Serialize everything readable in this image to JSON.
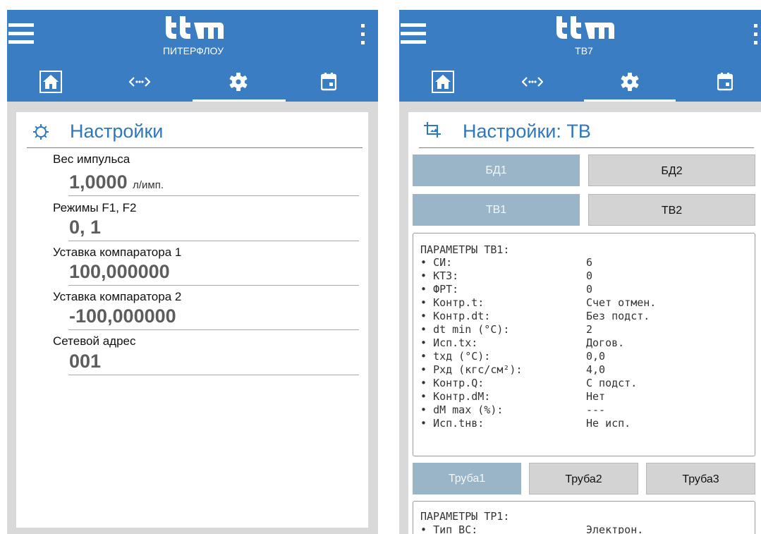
{
  "logo_text": "ttm",
  "left_screen": {
    "device_name": "ПИТЕРФЛОУ",
    "card_title": "Настройки",
    "settings": [
      {
        "label": "Вес импульса",
        "value": "1,0000",
        "unit": "л/имп."
      },
      {
        "label": "Режимы F1, F2",
        "value": "0, 1"
      },
      {
        "label": "Уставка компаратора 1",
        "value": "100,000000"
      },
      {
        "label": "Уставка компаратора 2",
        "value": "-100,000000"
      },
      {
        "label": "Сетевой адрес",
        "value": "001"
      }
    ]
  },
  "right_screen": {
    "device_name": "ТВ7",
    "card_title": "Настройки: ТВ",
    "db_buttons": [
      "БД1",
      "БД2"
    ],
    "tv_buttons": [
      "ТВ1",
      "ТВ2"
    ],
    "params_header": "ПАРАМЕТРЫ ТВ1:",
    "params": [
      {
        "name": "СИ:",
        "value": "6"
      },
      {
        "name": "КТЗ:",
        "value": "0"
      },
      {
        "name": "ФРТ:",
        "value": "0"
      },
      {
        "name": "Контр.t:",
        "value": "Счет отмен."
      },
      {
        "name": "Контр.dt:",
        "value": "Без подст."
      },
      {
        "name": "dt min (°C):",
        "value": "2"
      },
      {
        "name": "Исп.tx:",
        "value": "Догов."
      },
      {
        "name": "tхд (°C):",
        "value": "0,0"
      },
      {
        "name": "Рхд (кгс/см²):",
        "value": "4,0"
      },
      {
        "name": "Контр.Q:",
        "value": "С подст."
      },
      {
        "name": "Контр.dM:",
        "value": "Нет"
      },
      {
        "name": "dM max (%):",
        "value": "---"
      },
      {
        "name": "Исп.tнв:",
        "value": "Не исп."
      }
    ],
    "pipe_buttons": [
      "Труба1",
      "Труба2",
      "Труба3"
    ],
    "pipe_params_header": "ПАРАМЕТРЫ ТР1:",
    "pipe_params": [
      {
        "name": "Тип ВС:",
        "value": "Электрон."
      }
    ]
  },
  "icons": {
    "menu": "hamburger-menu-icon",
    "more": "kebab-more-icon",
    "home": "home-icon",
    "connection": "code-arrows-icon",
    "settings": "gear-icon",
    "calendar": "calendar-icon",
    "card_left": "gear-outline-icon",
    "card_right": "crop-icon"
  },
  "colors": {
    "header": "#3a7dc3",
    "accent_title": "#2f77bf",
    "button_active": "#9ab5c8",
    "button_inactive": "#d3d3d3"
  }
}
